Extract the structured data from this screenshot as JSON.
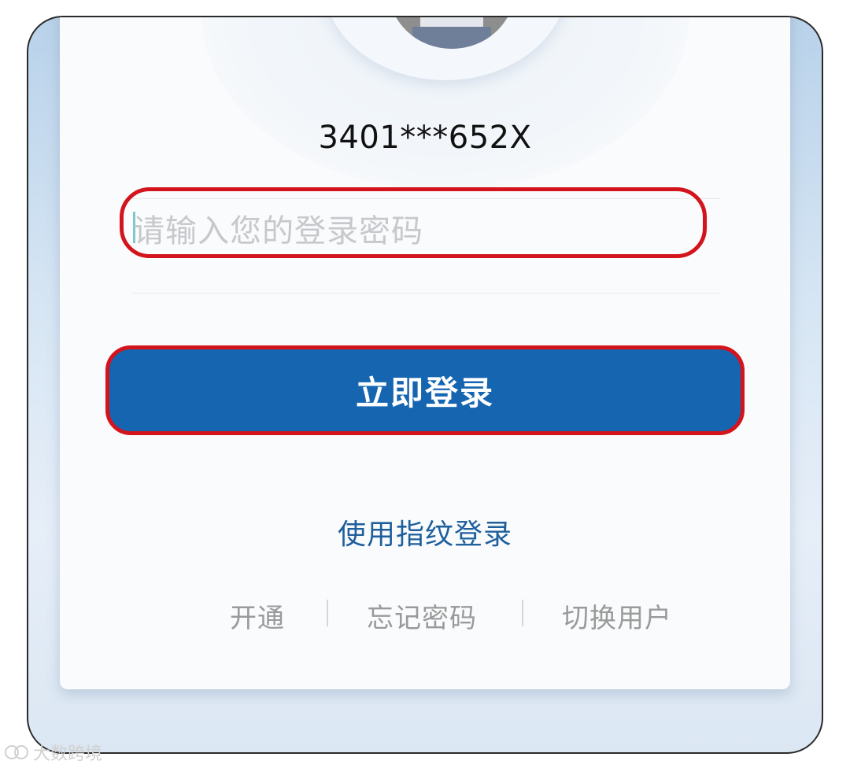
{
  "account": {
    "masked_id": "3401***652X"
  },
  "password": {
    "placeholder": "请输入您的登录密码",
    "value": ""
  },
  "login_button": {
    "label": "立即登录"
  },
  "fingerprint": {
    "label": "使用指纹登录"
  },
  "footer_links": [
    {
      "label": "开通"
    },
    {
      "label": "忘记密码"
    },
    {
      "label": "切换用户"
    }
  ],
  "watermark": {
    "text": "大数跨境"
  },
  "colors": {
    "primary": "#1565b0",
    "highlight": "#d4141c",
    "link": "#1e5f9c",
    "muted": "#9a9a9a"
  },
  "icons": {
    "avatar": "user-avatar-photo"
  }
}
